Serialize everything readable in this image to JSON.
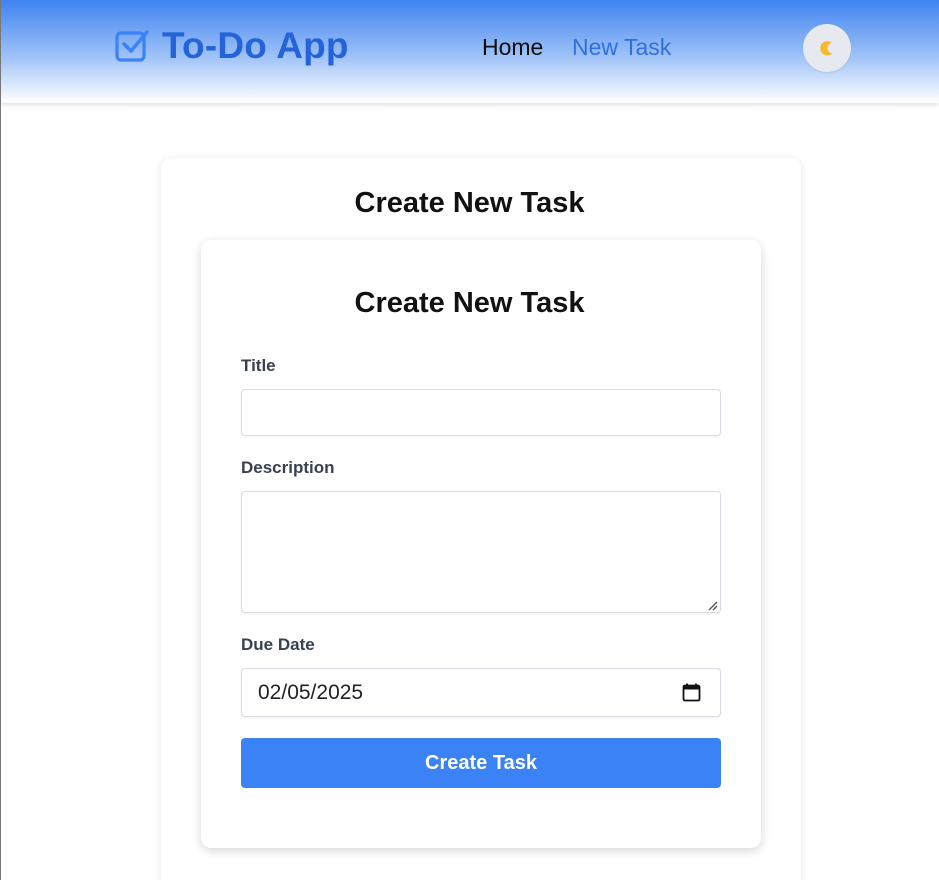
{
  "navbar": {
    "brand": "To-Do App",
    "links": [
      "Home",
      "New Task"
    ],
    "theme_toggle_icon": "moon-icon"
  },
  "outer_card": {
    "title": "Create New Task"
  },
  "form": {
    "title": "Create New Task",
    "title_label": "Title",
    "title_value": "",
    "description_label": "Description",
    "description_value": "",
    "due_label": "Due Date",
    "due_value": "02/05/2025",
    "submit_label": "Create Task"
  },
  "colors": {
    "brand": "#2463da",
    "active_link": "#2f6fde",
    "button": "#3b82f6",
    "moon": "#f5b82e"
  }
}
